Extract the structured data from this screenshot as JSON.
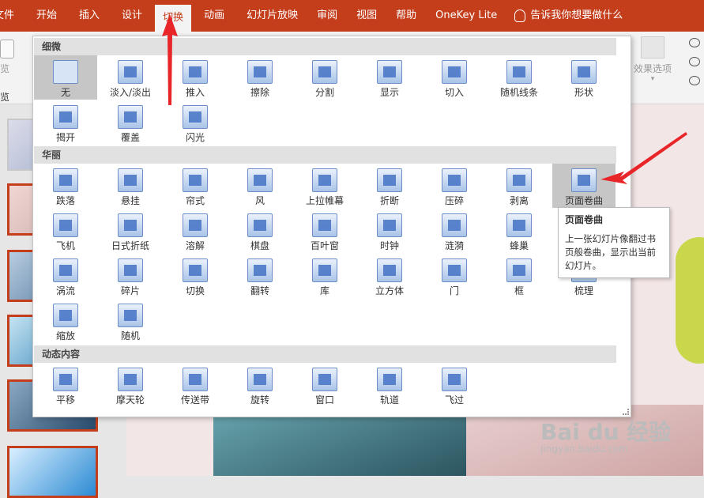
{
  "tabs": [
    {
      "label": "文件",
      "active": false
    },
    {
      "label": "开始",
      "active": false
    },
    {
      "label": "插入",
      "active": false
    },
    {
      "label": "设计",
      "active": false
    },
    {
      "label": "切换",
      "active": true
    },
    {
      "label": "动画",
      "active": false
    },
    {
      "label": "幻灯片放映",
      "active": false
    },
    {
      "label": "审阅",
      "active": false
    },
    {
      "label": "视图",
      "active": false
    },
    {
      "label": "帮助",
      "active": false
    },
    {
      "label": "OneKey Lite",
      "active": false
    }
  ],
  "tell_me": "告诉我你想要做什么",
  "ribbon": {
    "preview_top": "览",
    "preview_bottom": "览",
    "effect_options": "效果选项"
  },
  "sections": {
    "subtle": "细微",
    "exciting": "华丽",
    "dynamic": "动态内容"
  },
  "subtle_items": [
    "无",
    "淡入/淡出",
    "推入",
    "擦除",
    "分割",
    "显示",
    "切入",
    "随机线条",
    "形状",
    "揭开",
    "覆盖",
    "闪光"
  ],
  "exciting_items": [
    "跌落",
    "悬挂",
    "帘式",
    "风",
    "上拉帷幕",
    "折断",
    "压碎",
    "剥离",
    "页面卷曲",
    "飞机",
    "日式折纸",
    "溶解",
    "棋盘",
    "百叶窗",
    "时钟",
    "涟漪",
    "蜂巢",
    "闪耀",
    "涡流",
    "碎片",
    "切换",
    "翻转",
    "库",
    "立方体",
    "门",
    "框",
    "梳理",
    "缩放",
    "随机"
  ],
  "dynamic_items": [
    "平移",
    "摩天轮",
    "传送带",
    "旋转",
    "窗口",
    "轨道",
    "飞过"
  ],
  "tooltip": {
    "title": "页面卷曲",
    "body": "上一张幻灯片像翻过书页般卷曲，显示出当前幻灯片。"
  },
  "watermark": {
    "brand": "Bai du 经验",
    "url": "jingyan.baidu.com"
  },
  "colors": {
    "accent": "#c43e1c",
    "arrow": "#e8262a"
  }
}
